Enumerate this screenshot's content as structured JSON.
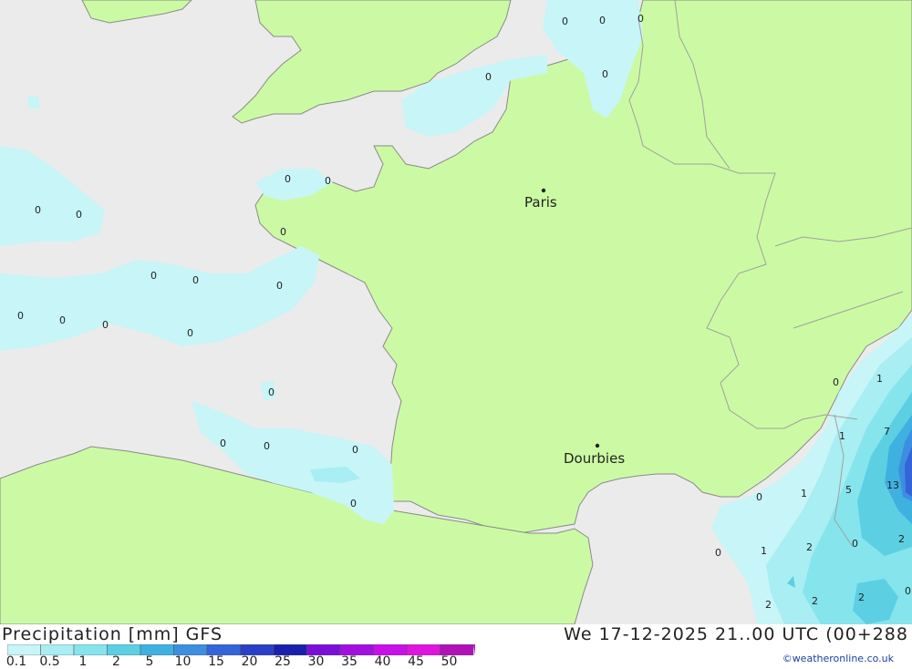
{
  "header": {
    "title_left": "Precipitation [mm] GFS",
    "title_right": "We 17-12-2025 21..00 UTC (00+288",
    "credit": "©weatheronline.co.uk"
  },
  "legend": {
    "values": [
      "0.1",
      "0.5",
      "1",
      "2",
      "5",
      "10",
      "15",
      "20",
      "25",
      "30",
      "35",
      "40",
      "45",
      "50"
    ],
    "colors": [
      "#c8f5f7",
      "#a8eef3",
      "#86e4ec",
      "#5ccfe3",
      "#3fb1e0",
      "#3d8ee0",
      "#3563d9",
      "#2a3fc7",
      "#1a1fae",
      "#7a10d8",
      "#a20fe0",
      "#c810e8",
      "#e014e0",
      "#b012b8"
    ]
  },
  "map": {
    "colors": {
      "sea": "#ebebeb",
      "land": "#ccfaa4",
      "border": "#a0a0a0",
      "coast": "#8a8a8a"
    },
    "cities": [
      {
        "name": "Paris"
      },
      {
        "name": "Dourbies"
      }
    ],
    "precip_labels": [
      "0",
      "0",
      "0",
      "0",
      "0",
      "0",
      "0",
      "0",
      "0",
      "0",
      "0",
      "0",
      "0",
      "0",
      "0",
      "0",
      "0",
      "0",
      "0",
      "0",
      "0",
      "0",
      "0",
      "0",
      "0",
      "0",
      "1",
      "1",
      "7",
      "5",
      "13",
      "1",
      "1",
      "2",
      "0",
      "2",
      "2",
      "2",
      "2",
      "0"
    ]
  }
}
